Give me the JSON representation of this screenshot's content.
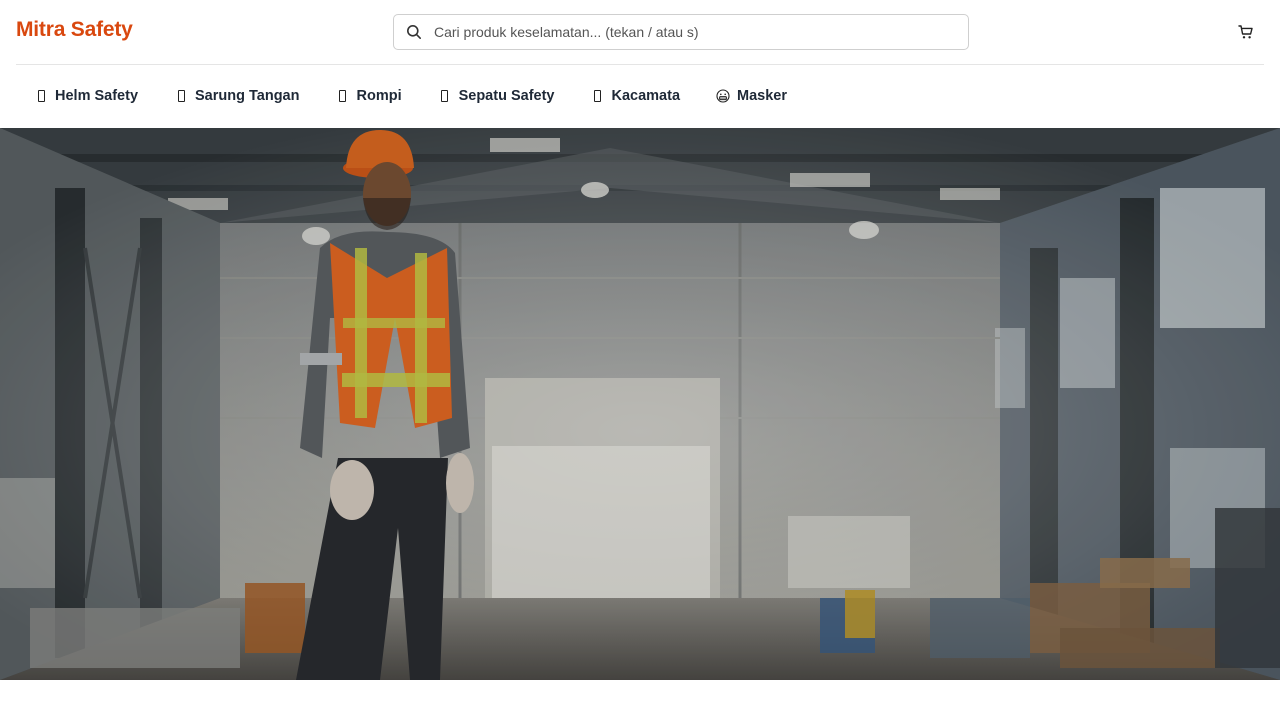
{
  "header": {
    "logo_text": "Mitra Safety",
    "search": {
      "placeholder": "Cari produk keselamatan... (tekan / atau s)",
      "value": ""
    },
    "cart_icon": "cart-icon"
  },
  "categories": [
    {
      "label": "Helm Safety",
      "icon": "missing-glyph-icon"
    },
    {
      "label": "Sarung Tangan",
      "icon": "missing-glyph-icon"
    },
    {
      "label": "Rompi",
      "icon": "missing-glyph-icon"
    },
    {
      "label": "Sepatu Safety",
      "icon": "missing-glyph-icon"
    },
    {
      "label": "Kacamata",
      "icon": "missing-glyph-icon"
    },
    {
      "label": "Masker",
      "icon": "mask-face-icon"
    }
  ],
  "hero": {
    "image": "safety worker in orange helmet and vest standing in warehouse"
  },
  "colors": {
    "brand": "#d9480f",
    "text": "#1f2937",
    "border": "#cfcfcf"
  }
}
